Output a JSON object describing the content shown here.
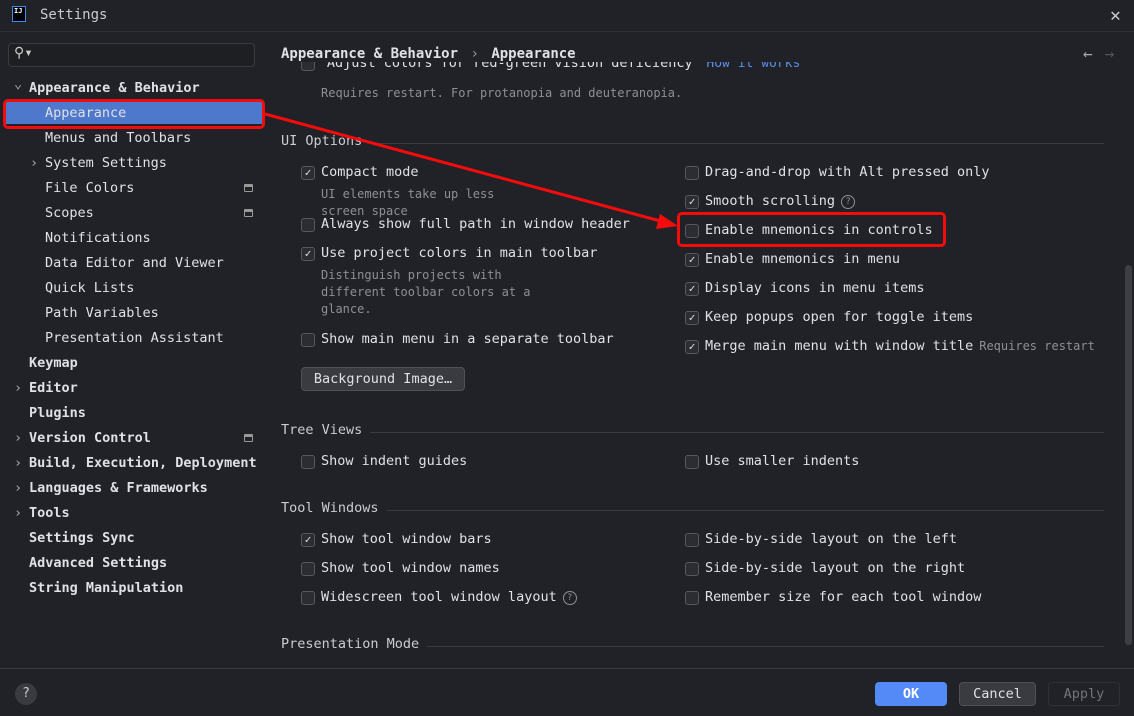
{
  "window": {
    "title": "Settings",
    "logo": "IJ"
  },
  "search": {
    "placeholder": ""
  },
  "sidebar": {
    "items": [
      {
        "label": "Appearance & Behavior",
        "expanded": true,
        "level": 0
      },
      {
        "label": "Appearance",
        "selected": true,
        "level": 1
      },
      {
        "label": "Menus and Toolbars",
        "level": 1
      },
      {
        "label": "System Settings",
        "level": 1,
        "collapsed": true
      },
      {
        "label": "File Colors",
        "level": 1,
        "pinned": true
      },
      {
        "label": "Scopes",
        "level": 1,
        "pinned": true
      },
      {
        "label": "Notifications",
        "level": 1
      },
      {
        "label": "Data Editor and Viewer",
        "level": 1
      },
      {
        "label": "Quick Lists",
        "level": 1
      },
      {
        "label": "Path Variables",
        "level": 1
      },
      {
        "label": "Presentation Assistant",
        "level": 1
      },
      {
        "label": "Keymap",
        "level": 0
      },
      {
        "label": "Editor",
        "level": 0,
        "collapsed": true
      },
      {
        "label": "Plugins",
        "level": 0
      },
      {
        "label": "Version Control",
        "level": 0,
        "collapsed": true,
        "pinned": true
      },
      {
        "label": "Build, Execution, Deployment",
        "level": 0,
        "collapsed": true
      },
      {
        "label": "Languages & Frameworks",
        "level": 0,
        "collapsed": true
      },
      {
        "label": "Tools",
        "level": 0,
        "collapsed": true
      },
      {
        "label": "Settings Sync",
        "level": 0
      },
      {
        "label": "Advanced Settings",
        "level": 0
      },
      {
        "label": "String Manipulation",
        "level": 0
      }
    ]
  },
  "breadcrumb": {
    "parent": "Appearance & Behavior",
    "sep": "›",
    "current": "Appearance"
  },
  "top": {
    "option": "Adjust colors for red-green vision deficiency",
    "link": "How it works",
    "hint": "Requires restart. For protanopia and deuteranopia."
  },
  "ui_options": {
    "title": "UI Options",
    "left": [
      {
        "label": "Compact mode",
        "checked": true,
        "hint": "UI elements take up less screen space"
      },
      {
        "label": "Always show full path in window header",
        "checked": false
      },
      {
        "label": "Use project colors in main toolbar",
        "checked": true,
        "hint": "Distinguish projects with different toolbar colors at a glance."
      },
      {
        "label": "Show main menu in a separate toolbar",
        "checked": false
      }
    ],
    "right": [
      {
        "label": "Drag-and-drop with Alt pressed only",
        "checked": false
      },
      {
        "label": "Smooth scrolling",
        "checked": true,
        "help": true
      },
      {
        "label": "Enable mnemonics in controls",
        "checked": false,
        "highlighted": true
      },
      {
        "label": "Enable mnemonics in menu",
        "checked": true
      },
      {
        "label": "Display icons in menu items",
        "checked": true
      },
      {
        "label": "Keep popups open for toggle items",
        "checked": true
      },
      {
        "label": "Merge main menu with window title",
        "checked": true,
        "note": "Requires restart"
      }
    ],
    "background_button": "Background Image…"
  },
  "tree_views": {
    "title": "Tree Views",
    "left": {
      "label": "Show indent guides",
      "checked": false
    },
    "right": {
      "label": "Use smaller indents",
      "checked": false
    }
  },
  "tool_windows": {
    "title": "Tool Windows",
    "left": [
      {
        "label": "Show tool window bars",
        "checked": true
      },
      {
        "label": "Show tool window names",
        "checked": false
      },
      {
        "label": "Widescreen tool window layout",
        "checked": false,
        "help": true
      }
    ],
    "right": [
      {
        "label": "Side-by-side layout on the left",
        "checked": false
      },
      {
        "label": "Side-by-side layout on the right",
        "checked": false
      },
      {
        "label": "Remember size for each tool window",
        "checked": false
      }
    ]
  },
  "presentation": {
    "title": "Presentation Mode"
  },
  "footer": {
    "help": "?",
    "ok": "OK",
    "cancel": "Cancel",
    "apply": "Apply"
  },
  "colors": {
    "accent": "#4d78cc",
    "ok": "#548af7",
    "annotation": "#f40c0c"
  }
}
